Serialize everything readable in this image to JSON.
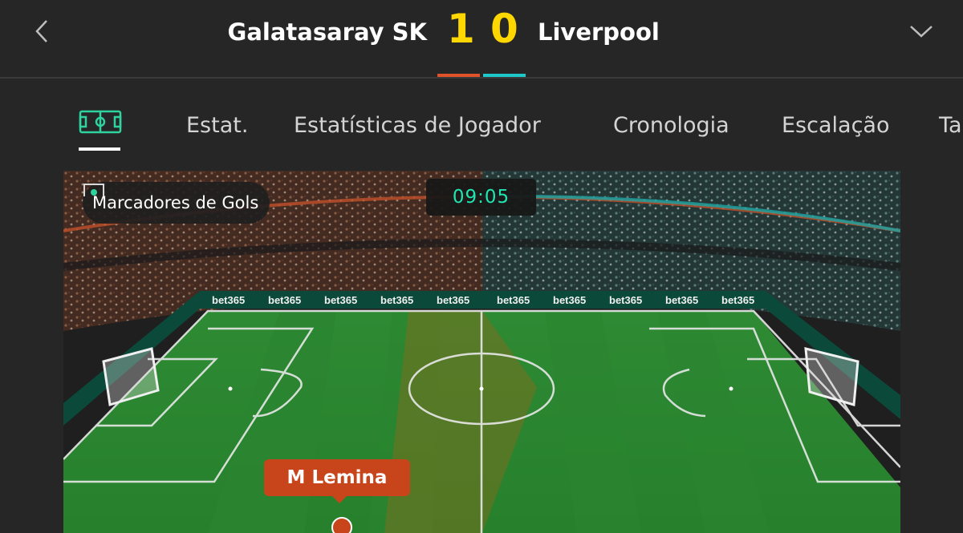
{
  "header": {
    "home_team": "Galatasaray SK",
    "away_team": "Liverpool",
    "home_score": "1",
    "away_score": "0",
    "home_color": "#e0532a",
    "away_color": "#1ec8c8",
    "score_color": "#ffd700",
    "back_icon": "chevron-left-icon",
    "expand_icon": "chevron-down-icon"
  },
  "tabs": {
    "pitch_icon": "pitch-icon",
    "items": [
      "Estat.",
      "Estatísticas de Jogador",
      "Cronologia",
      "Escalação",
      "Ta"
    ]
  },
  "match_view": {
    "scorers_label": "Marcadores de Gols",
    "scorers_icon": "goal-icon",
    "clock": "09:05",
    "player_label": "M Lemina",
    "board_text": "bet365",
    "pitch_color": "#2a8a2e"
  }
}
